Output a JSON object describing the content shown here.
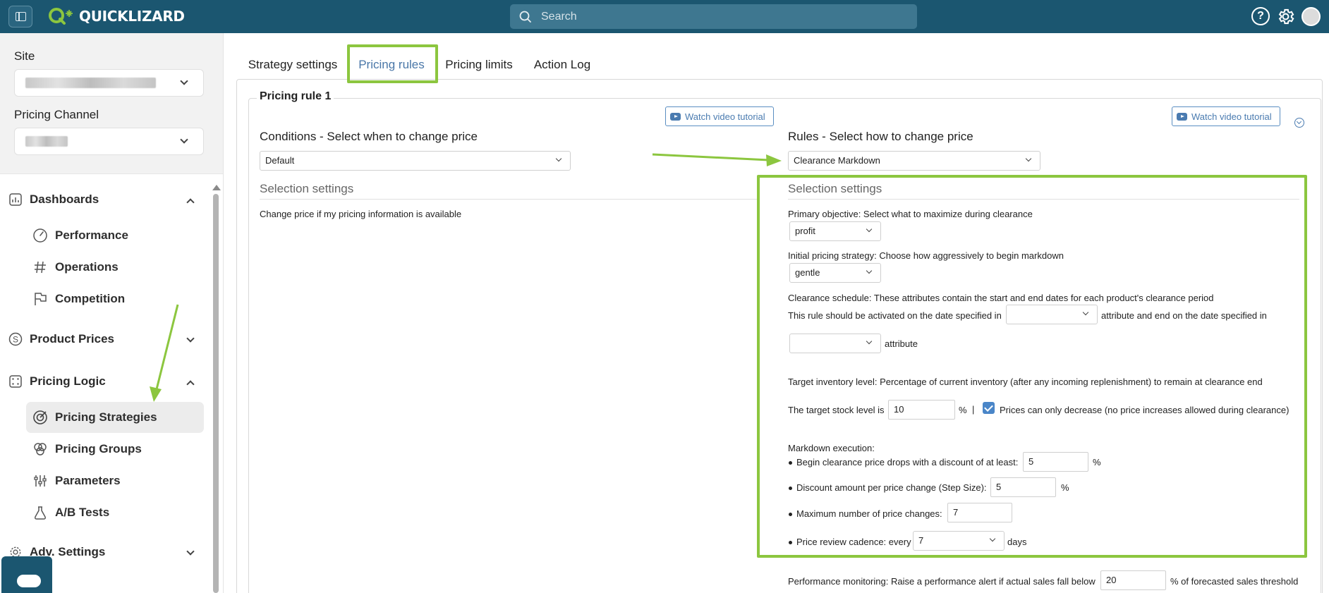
{
  "app": {
    "brand": "QUICKLIZARD",
    "brand_color": "#1b5670",
    "accent_color": "#8cc63f"
  },
  "search": {
    "placeholder": "Search"
  },
  "sidebar": {
    "site_label": "Site",
    "channel_label": "Pricing Channel",
    "sections": [
      {
        "label": "Dashboards",
        "icon": "bar-chart-icon",
        "expanded": true
      },
      {
        "label": "Product Prices",
        "icon": "dollar-icon",
        "expanded": false
      },
      {
        "label": "Pricing Logic",
        "icon": "dice-icon",
        "expanded": true
      },
      {
        "label": "Adv. Settings",
        "icon": "gear-icon",
        "expanded": false
      }
    ],
    "dashboard_items": [
      {
        "label": "Performance",
        "icon": "gauge-icon"
      },
      {
        "label": "Operations",
        "icon": "hash-icon"
      },
      {
        "label": "Competition",
        "icon": "flag-icon"
      }
    ],
    "logic_items": [
      {
        "label": "Pricing Strategies",
        "icon": "target-icon",
        "active": true
      },
      {
        "label": "Pricing Groups",
        "icon": "circles-icon",
        "active": false
      },
      {
        "label": "Parameters",
        "icon": "sliders-icon",
        "active": false
      },
      {
        "label": "A/B Tests",
        "icon": "flask-icon",
        "active": false
      }
    ]
  },
  "tabs": [
    "Strategy settings",
    "Pricing rules",
    "Pricing limits",
    "Action Log"
  ],
  "active_tab": "Pricing rules",
  "rule": {
    "title": "Pricing rule 1",
    "video_label": "Watch video tutorial",
    "conditions": {
      "heading": "Conditions - Select when to change price",
      "selected": "Default",
      "section_title": "Selection settings",
      "text": "Change price if my pricing information is available"
    },
    "rules": {
      "heading": "Rules - Select how to change price",
      "selected": "Clearance Markdown",
      "section_title": "Selection settings",
      "primary_objective_label": "Primary objective",
      "primary_objective_desc": ": Select what to maximize during clearance",
      "primary_objective_value": "profit",
      "initial_strategy_label": "Initial pricing strategy",
      "initial_strategy_desc": ": Choose how aggressively to begin markdown",
      "initial_strategy_value": "gentle",
      "schedule_label": "Clearance schedule",
      "schedule_desc": ": These attributes contain the start and end dates for each product's clearance period",
      "schedule_line_start": "This rule should be activated on the date specified in",
      "schedule_line_mid": "attribute and end on the date specified in",
      "schedule_line_end": "attribute",
      "schedule_start_value": "",
      "schedule_end_value": "",
      "target_label": "Target inventory level",
      "target_desc": ": Percentage of current inventory (after any incoming replenishment) to remain at clearance end",
      "target_stock_text": "The target stock level is",
      "target_stock_value": "10",
      "percent_sign": "%",
      "separator": "|",
      "decrease_only_label": "Prices can only decrease (no price increases allowed during clearance)",
      "decrease_only_checked": true,
      "markdown_label": "Markdown execution",
      "markdown_colon": ":",
      "begin_label": "Begin clearance price drops with a discount of at least:",
      "begin_value": "5",
      "step_label": "Discount amount per price change (Step Size):",
      "step_value": "5",
      "max_changes_label": "Maximum number of price changes:",
      "max_changes_value": "7",
      "cadence_label": "Price review cadence: every",
      "cadence_value": "7",
      "cadence_unit": "days",
      "monitoring_label": "Performance monitoring",
      "monitoring_desc": ": Raise a performance alert if actual sales fall below",
      "monitoring_value": "20",
      "monitoring_suffix": "% of forecasted sales threshold"
    }
  }
}
